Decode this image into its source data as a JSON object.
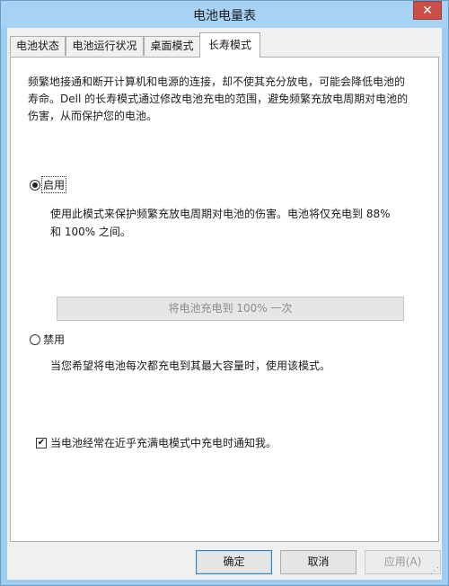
{
  "window": {
    "title": "电池电量表",
    "close_glyph": "✕"
  },
  "tabs": [
    {
      "label": "电池状态"
    },
    {
      "label": "电池运行状况"
    },
    {
      "label": "桌面模式"
    },
    {
      "label": "长寿模式"
    }
  ],
  "panel": {
    "description_lines": [
      "频繁地接通和断开计算机和电源的连接，却不使其充分放电，可能会降低电池的",
      "寿命。Dell 的长寿模式通过修改电池充电的范围，避免频繁充放电周期对电池的",
      "伤害，从而保护您的电池。"
    ],
    "enable": {
      "label": "启用",
      "checked": true,
      "detail_lines": [
        "使用此模式来保护频繁充放电周期对电池的伤害。电池将仅充电到 88%",
        "和 100% 之间。"
      ]
    },
    "charge_once_button": "将电池充电到 100% 一次",
    "disable": {
      "label": "禁用",
      "checked": false,
      "detail_lines": [
        "当您希望将电池每次都充电到其最大容量时，使用该模式。"
      ]
    },
    "notify": {
      "label": "当电池经常在近乎充满电模式中充电时通知我。",
      "checked": true,
      "check_glyph": "✔"
    }
  },
  "buttons": {
    "ok": "确定",
    "cancel": "取消",
    "apply": "应用(A)"
  },
  "colors": {
    "title_bar": "#a8d2f3",
    "close_button": "#c7504a"
  }
}
